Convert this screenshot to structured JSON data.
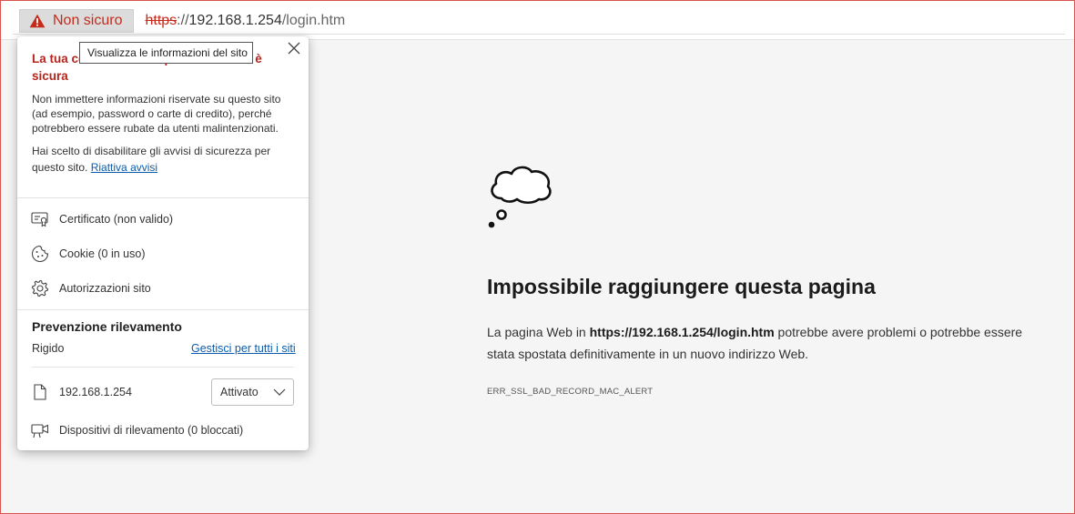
{
  "addressbar": {
    "security_label": "Non sicuro",
    "url_protocol": "https",
    "url_separator": "://",
    "url_host": "192.168.1.254",
    "url_path": "/login.htm"
  },
  "tooltip": {
    "text": "Visualizza le informazioni del sito"
  },
  "popup": {
    "title": "La tua connessione a questo sito non è sicura",
    "description": "Non immettere informazioni riservate su questo sito (ad esempio, password o carte di credito), perché potrebbero essere rubate da utenti malintenzionati.",
    "warnings_text": "Hai scelto di disabilitare gli avvisi di sicurezza per questo sito.",
    "reenable_link": "Riattiva avvisi",
    "items": [
      {
        "label": "Certificato (non valido)",
        "icon": "certificate-icon"
      },
      {
        "label": "Cookie (0 in uso)",
        "icon": "cookie-icon"
      },
      {
        "label": "Autorizzazioni sito",
        "icon": "gear-icon"
      }
    ],
    "tracking": {
      "title": "Prevenzione rilevamento",
      "level": "Rigido",
      "manage_link": "Gestisci per tutti i siti",
      "site": "192.168.1.254",
      "site_state": "Attivato",
      "trackers": "Dispositivi di rilevamento (0 bloccati)"
    }
  },
  "error_page": {
    "title": "Impossibile raggiungere questa pagina",
    "body_prefix": "La pagina Web in ",
    "body_url": "https://192.168.1.254/login.htm",
    "body_suffix": " potrebbe avere problemi o potrebbe essere stata spostata definitivamente in un nuovo indirizzo Web.",
    "error_code": "ERR_SSL_BAD_RECORD_MAC_ALERT"
  },
  "colors": {
    "warning_red": "#c42b1c",
    "link_blue": "#0b5cad",
    "page_background": "#f5f5f5"
  }
}
